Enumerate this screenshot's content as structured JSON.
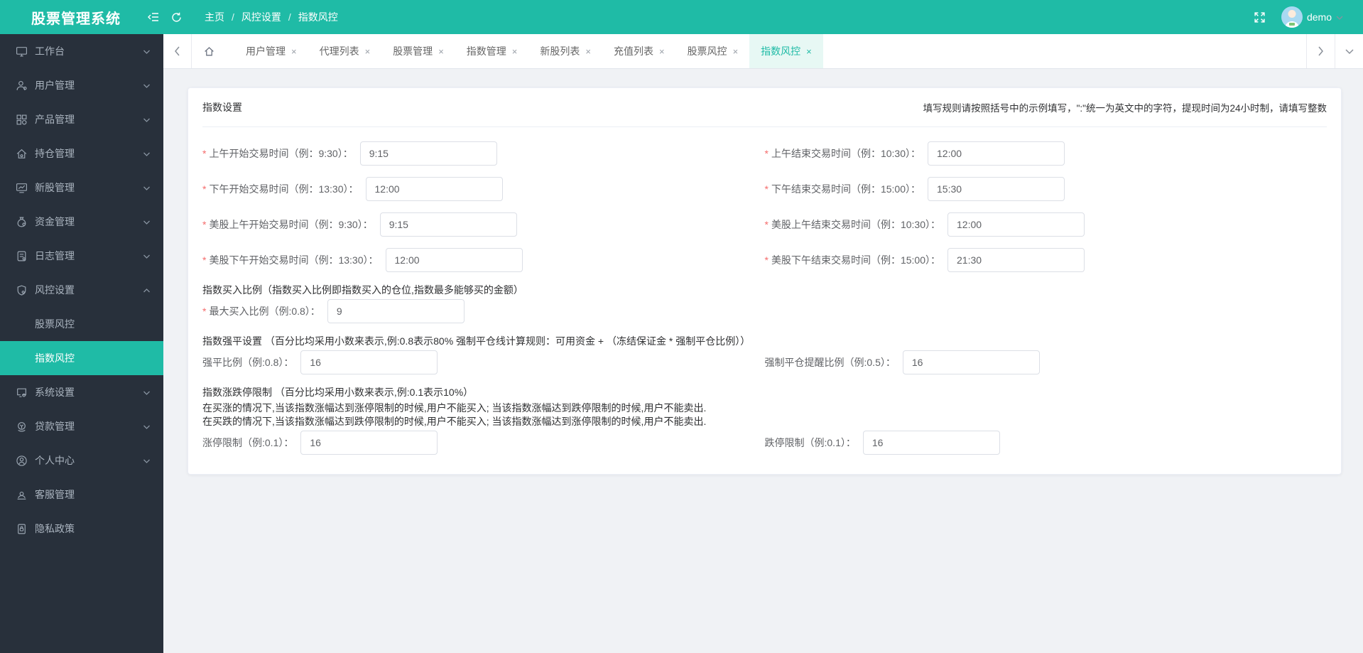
{
  "colors": {
    "accent": "#1FBBA6",
    "header_bg": "#1FBBA6",
    "sidebar_bg": "#28303B",
    "sidebar_text": "#AAB4BF",
    "active_submenu_bg": "#1FBBA6",
    "content_bg": "#F0F2F5",
    "card_bg": "#FFFFFF",
    "input_border": "#DCDFE6",
    "label_text": "#606266",
    "title_text": "#303133",
    "required_mark_color": "#F56C6C",
    "tab_active_bg": "#E7F8F4",
    "tab_text": "#666666"
  },
  "header": {
    "logo": "股票管理系统",
    "breadcrumb": {
      "items": [
        "主页",
        "风控设置",
        "指数风控"
      ],
      "sep": "/"
    },
    "user": {
      "name": "demo"
    }
  },
  "sidebar": {
    "items": [
      {
        "label": "工作台"
      },
      {
        "label": "用户管理"
      },
      {
        "label": "产品管理"
      },
      {
        "label": "持仓管理"
      },
      {
        "label": "新股管理"
      },
      {
        "label": "资金管理"
      },
      {
        "label": "日志管理"
      },
      {
        "label": "风控设置"
      },
      {
        "label": "系统设置"
      },
      {
        "label": "贷款管理"
      },
      {
        "label": "个人中心"
      },
      {
        "label": "客服管理"
      },
      {
        "label": "隐私政策"
      }
    ],
    "submenu": [
      {
        "label": "股票风控"
      },
      {
        "label": "指数风控"
      }
    ]
  },
  "tabs": {
    "close_glyph": "×",
    "items": [
      {
        "label": "用户管理"
      },
      {
        "label": "代理列表"
      },
      {
        "label": "股票管理"
      },
      {
        "label": "指数管理"
      },
      {
        "label": "新股列表"
      },
      {
        "label": "充值列表"
      },
      {
        "label": "股票风控"
      },
      {
        "label": "指数风控"
      }
    ]
  },
  "card": {
    "title": "指数设置",
    "note": "填写规则请按照括号中的示例填写，\":\"统一为英文中的字符，提现时间为24小时制，请填写整数"
  },
  "form": {
    "required_mark": "*",
    "fields": [
      {
        "label": "上午开始交易时间（例：9:30）：",
        "value": "9:15"
      },
      {
        "label": "上午结束交易时间（例：10:30）：",
        "value": "12:00"
      },
      {
        "label": "下午开始交易时间（例：13:30）：",
        "value": "12:00"
      },
      {
        "label": "下午结束交易时间（例：15:00）：",
        "value": "15:30"
      },
      {
        "label": "美股上午开始交易时间（例：9:30）：",
        "value": "9:15"
      },
      {
        "label": "美股上午结束交易时间（例：10:30）：",
        "value": "12:00"
      },
      {
        "label": "美股下午开始交易时间（例：13:30）：",
        "value": "12:00"
      },
      {
        "label": "美股下午结束交易时间（例：15:00）：",
        "value": "21:30"
      },
      {
        "label": "最大买入比例（例:0.8）：",
        "value": "9"
      },
      {
        "label": "强平比例（例:0.8）：",
        "value": "16"
      },
      {
        "label": "强制平仓提醒比例（例:0.5）：",
        "value": "16"
      },
      {
        "label": "涨停限制（例:0.1）：",
        "value": "16"
      },
      {
        "label": "跌停限制（例:0.1）：",
        "value": "16"
      }
    ],
    "sections": {
      "buy_ratio_title": "指数买入比例（指数买入比例即指数买入的仓位,指数最多能够买的金额）",
      "liquidation_title": "指数强平设置 （百分比均采用小数来表示,例:0.8表示80% 强制平仓线计算规则：可用资金 + （冻结保证金 * 强制平仓比例））",
      "limit_title": "指数涨跌停限制 （百分比均采用小数来表示,例:0.1表示10%）",
      "limit_line2": "在买涨的情况下,当该指数涨幅达到涨停限制的时候,用户不能买入; 当该指数涨幅达到跌停限制的时候,用户不能卖出.",
      "limit_line3": "在买跌的情况下,当该指数涨幅达到跌停限制的时候,用户不能买入; 当该指数涨幅达到涨停限制的时候,用户不能卖出."
    }
  }
}
